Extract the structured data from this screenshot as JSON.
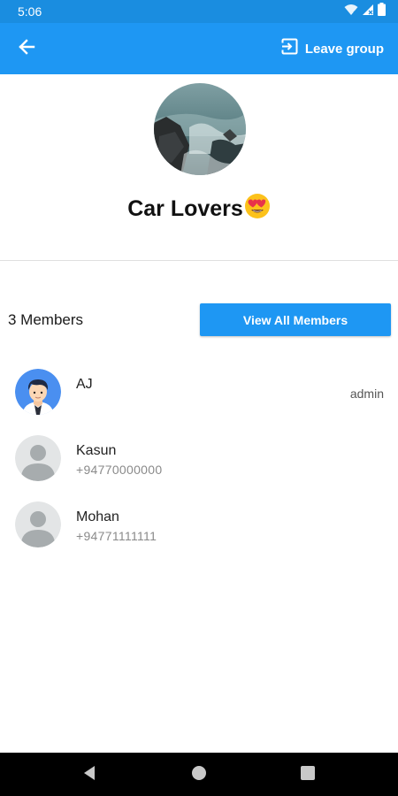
{
  "status_bar": {
    "time": "5:06",
    "icons": [
      "wifi-icon",
      "signal-icon",
      "battery-icon"
    ]
  },
  "app_bar": {
    "back_icon": "arrow-left-icon",
    "leave_icon": "exit-icon",
    "leave_label": "Leave group",
    "color": "#1e97f3"
  },
  "group": {
    "name": "Car Lovers",
    "emoji": "smiling-face-with-heart-eyes"
  },
  "members_section": {
    "count_label": "3 Members",
    "view_all_label": "View All Members",
    "members": [
      {
        "name": "AJ",
        "phone": "",
        "role": "admin",
        "avatar": "cartoon-man-avatar"
      },
      {
        "name": "Kasun",
        "phone": "+94770000000",
        "role": "",
        "avatar": "default-person-avatar"
      },
      {
        "name": "Mohan",
        "phone": "+94771111111",
        "role": "",
        "avatar": "default-person-avatar"
      }
    ]
  },
  "nav_bar": {
    "icons": [
      "nav-back-icon",
      "nav-home-icon",
      "nav-recents-icon"
    ]
  }
}
